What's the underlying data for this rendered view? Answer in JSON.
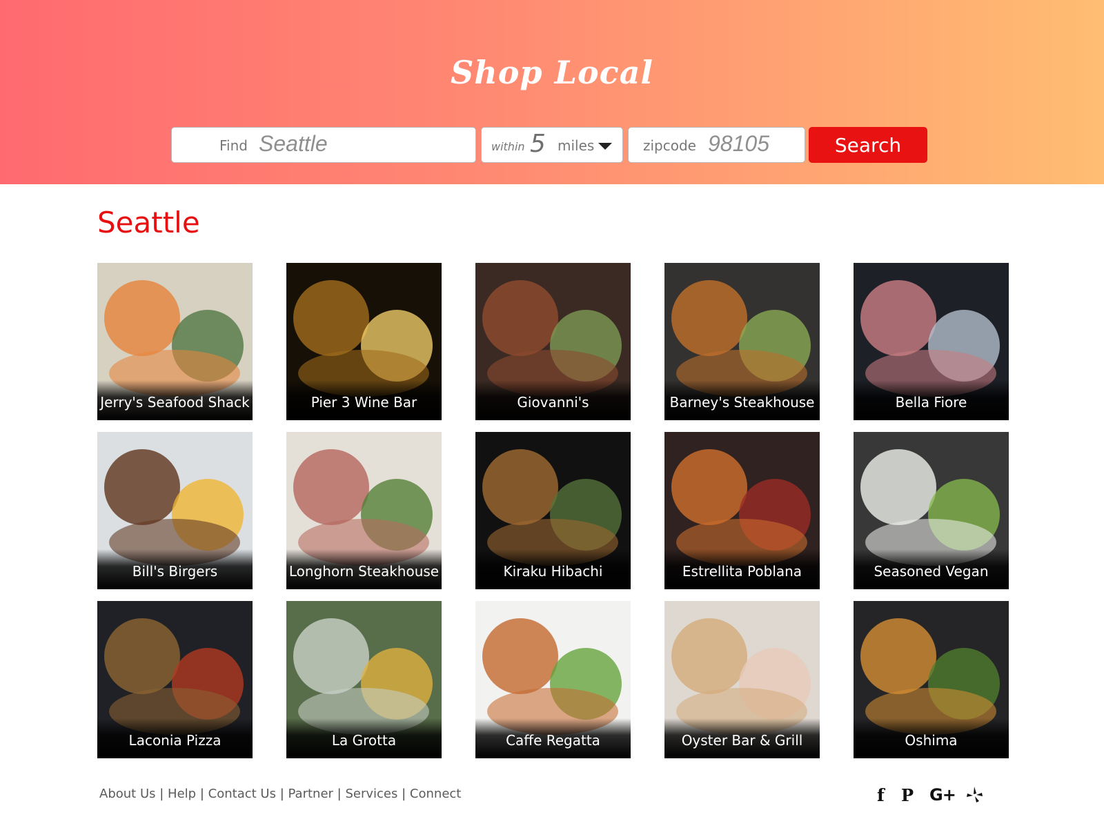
{
  "header": {
    "title": "Shop Local",
    "search": {
      "find_label": "Find",
      "find_value": "Seattle",
      "within_label": "within",
      "distance_value": "5",
      "distance_unit": "miles",
      "zip_label": "zipcode",
      "zip_value": "98105",
      "search_button": "Search"
    }
  },
  "main": {
    "city_heading": "Seattle",
    "restaurants": [
      {
        "name": "Jerry's Seafood Shack",
        "theme": [
          "#d7d1c1",
          "#e7853e",
          "#4e7641"
        ]
      },
      {
        "name": "Pier 3 Wine Bar",
        "theme": [
          "#161006",
          "#9e6a1c",
          "#f2ce69"
        ]
      },
      {
        "name": "Giovanni's",
        "theme": [
          "#3b2a24",
          "#8e4a2e",
          "#7c9b55"
        ]
      },
      {
        "name": "Barney's Steakhouse",
        "theme": [
          "#343230",
          "#bd6e2b",
          "#8aab55"
        ]
      },
      {
        "name": "Bella Fiore",
        "theme": [
          "#1d2027",
          "#c67c81",
          "#b6c1cf"
        ]
      },
      {
        "name": "Bill's Birgers",
        "theme": [
          "#dbdfe2",
          "#633922",
          "#f0b531"
        ]
      },
      {
        "name": "Longhorn Steakhouse",
        "theme": [
          "#e4dfd7",
          "#b76a60",
          "#527f35"
        ]
      },
      {
        "name": "Kiraku Hibachi",
        "theme": [
          "#111111",
          "#9c6830",
          "#55733a"
        ]
      },
      {
        "name": "Estrellita Poblana",
        "theme": [
          "#2f2220",
          "#cc6d2d",
          "#9c2c25"
        ]
      },
      {
        "name": "Seasoned Vegan",
        "theme": [
          "#393838",
          "#e9ece7",
          "#85b84d"
        ]
      },
      {
        "name": "Laconia Pizza",
        "theme": [
          "#202126",
          "#8a6332",
          "#b33a23"
        ]
      },
      {
        "name": "La Grotta",
        "theme": [
          "#586d4a",
          "#c7cec4",
          "#e1b13f"
        ]
      },
      {
        "name": "Caffe Regatta",
        "theme": [
          "#f2f2f0",
          "#c66d33",
          "#64a33a"
        ]
      },
      {
        "name": "Oyster Bar & Grill",
        "theme": [
          "#ded8d1",
          "#d6ad7d",
          "#e8c9b9"
        ]
      },
      {
        "name": "Oshima",
        "theme": [
          "#252528",
          "#d08b32",
          "#4f7e2e"
        ]
      }
    ]
  },
  "footer": {
    "links": [
      "About Us",
      "Help",
      "Contact Us",
      "Partner",
      "Services",
      "Connect"
    ],
    "separator": "|",
    "social": {
      "facebook": "f",
      "pinterest": "P",
      "googleplus": "G+"
    }
  }
}
